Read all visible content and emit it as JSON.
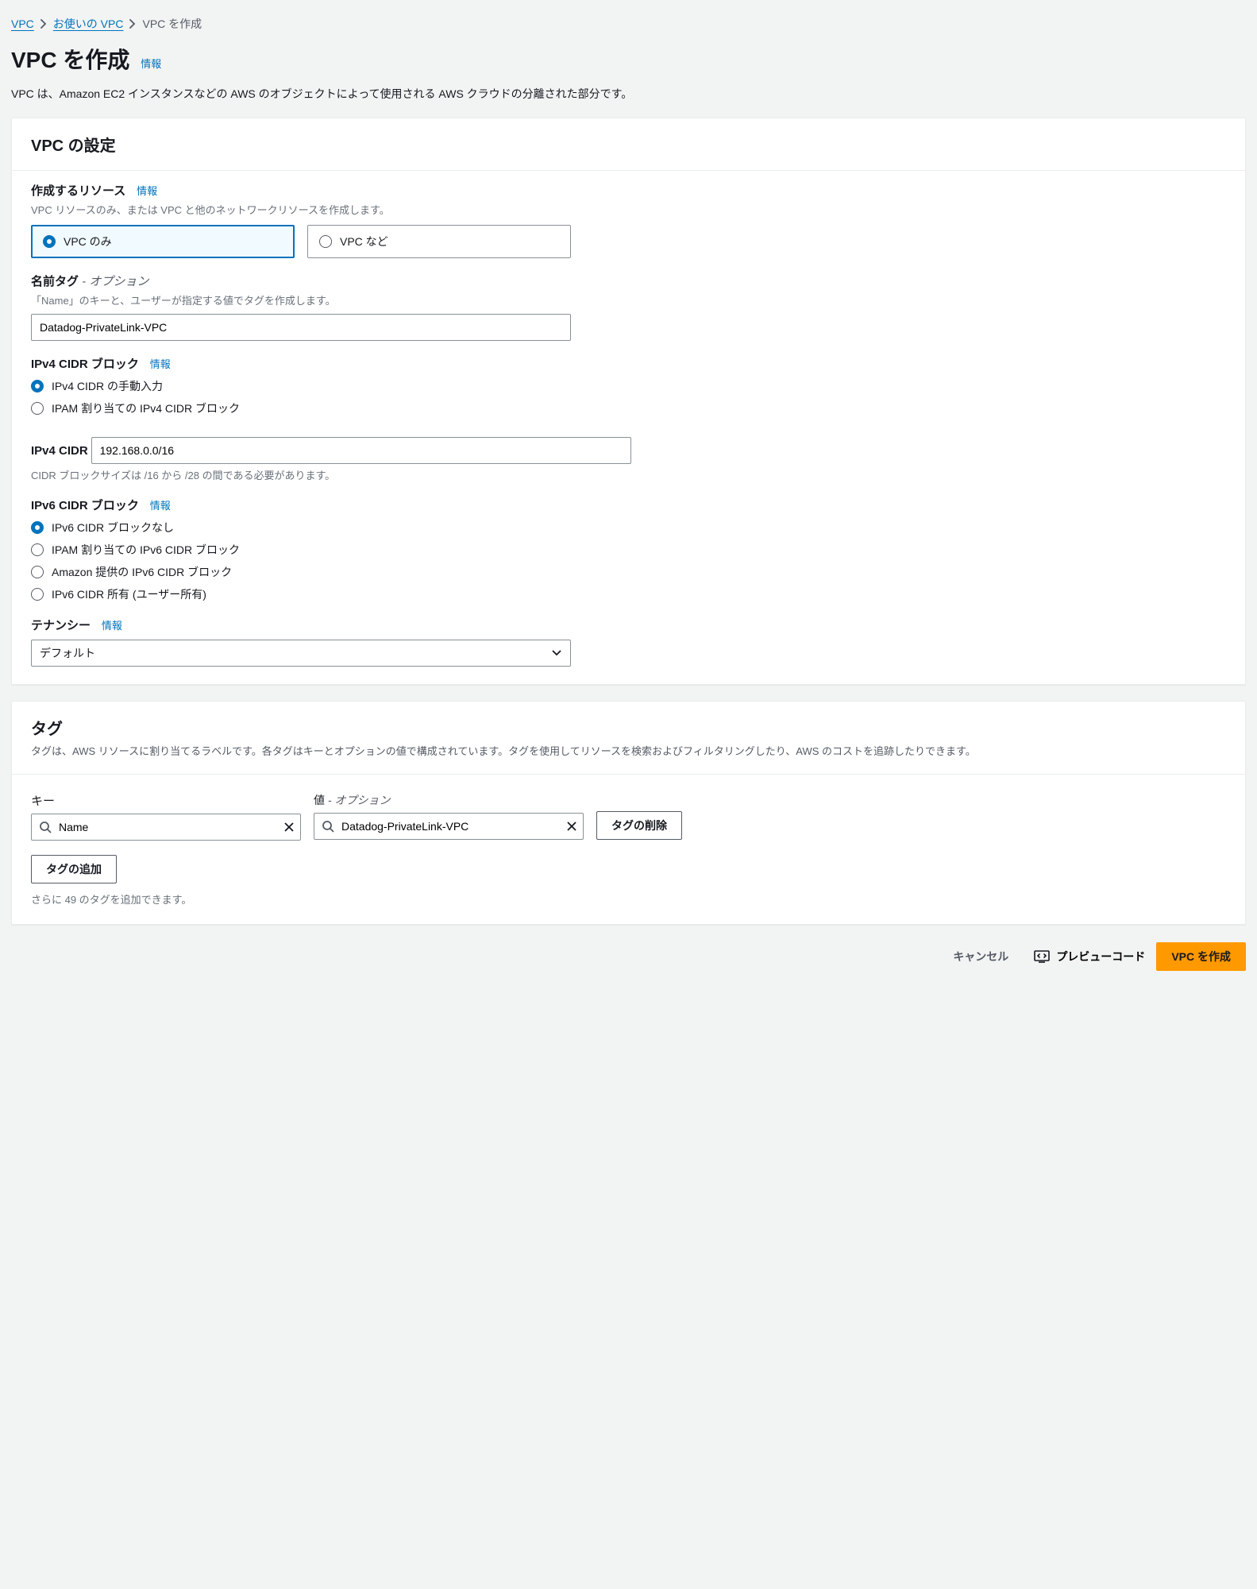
{
  "breadcrumb": {
    "root": "VPC",
    "parent": "お使いの VPC",
    "current": "VPC を作成"
  },
  "header": {
    "title": "VPC を作成",
    "info": "情報",
    "desc": "VPC は、Amazon EC2 インスタンスなどの AWS のオブジェクトによって使用される AWS クラウドの分離された部分です。"
  },
  "settings": {
    "title": "VPC の設定",
    "resources": {
      "label": "作成するリソース",
      "info": "情報",
      "hint": "VPC リソースのみ、または VPC と他のネットワークリソースを作成します。",
      "opt_only": "VPC のみ",
      "opt_more": "VPC など"
    },
    "name": {
      "label": "名前タグ",
      "optional": " - オプション",
      "hint": "「Name」のキーと、ユーザーが指定する値でタグを作成します。",
      "value": "Datadog-PrivateLink-VPC"
    },
    "ipv4block": {
      "label": "IPv4 CIDR ブロック",
      "info": "情報",
      "opt_manual": "IPv4 CIDR の手動入力",
      "opt_ipam": "IPAM 割り当ての IPv4 CIDR ブロック"
    },
    "ipv4cidr": {
      "label": "IPv4 CIDR",
      "value": "192.168.0.0/16",
      "hint": "CIDR ブロックサイズは /16 から /28 の間である必要があります。"
    },
    "ipv6block": {
      "label": "IPv6 CIDR ブロック",
      "info": "情報",
      "opt_none": "IPv6 CIDR ブロックなし",
      "opt_ipam": "IPAM 割り当ての IPv6 CIDR ブロック",
      "opt_amazon": "Amazon 提供の IPv6 CIDR ブロック",
      "opt_own": "IPv6 CIDR 所有 (ユーザー所有)"
    },
    "tenancy": {
      "label": "テナンシー",
      "info": "情報",
      "value": "デフォルト"
    }
  },
  "tags": {
    "title": "タグ",
    "desc": "タグは、AWS リソースに割り当てるラベルです。各タグはキーとオプションの値で構成されています。タグを使用してリソースを検索およびフィルタリングしたり、AWS のコストを追跡したりできます。",
    "key_label": "キー",
    "value_label": "値",
    "value_optional": " - オプション",
    "key_value": "Name",
    "val_value": "Datadog-PrivateLink-VPC",
    "remove": "タグの削除",
    "add": "タグの追加",
    "remaining": "さらに 49 のタグを追加できます。"
  },
  "footer": {
    "cancel": "キャンセル",
    "preview": "プレビューコード",
    "create": "VPC を作成"
  }
}
